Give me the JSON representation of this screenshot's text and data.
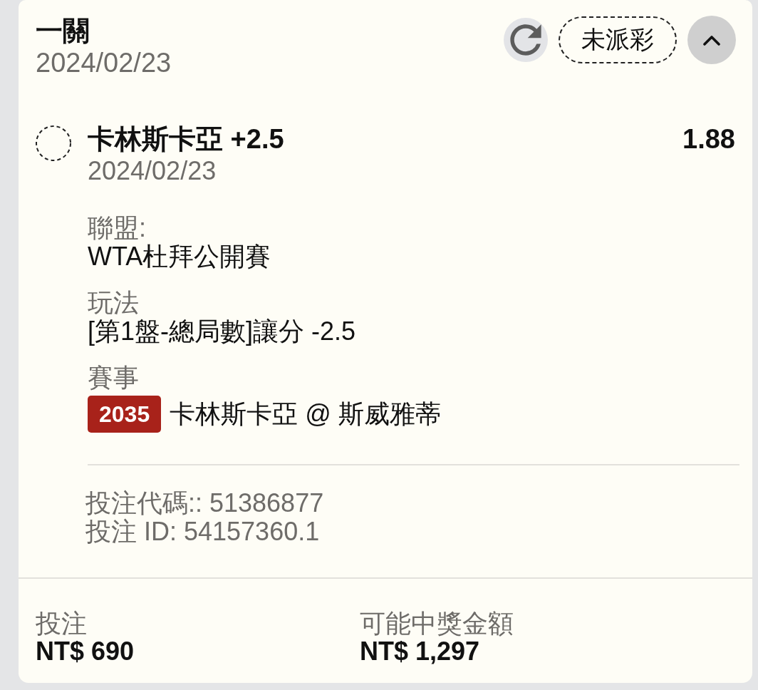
{
  "bet_card": {
    "title": "一關",
    "date": "2024/02/23",
    "status": "未派彩",
    "expanded": true
  },
  "selection": {
    "kind": "pending",
    "name": "卡林斯卡亞 +2.5",
    "odds": "1.88",
    "date": "2024/02/23",
    "details": [
      {
        "kind": "text",
        "label": "聯盟:",
        "value": "WTA杜拜公開賽"
      },
      {
        "kind": "text",
        "label": "玩法",
        "value": "[第1盤-總局數]讓分 -2.5"
      },
      {
        "kind": "match",
        "label": "賽事",
        "badge": "2035",
        "value": "卡林斯卡亞 @ 斯威雅蒂"
      }
    ],
    "bet_code": "投注代碼:: 51386877",
    "bet_id": "投注 ID: 54157360.1"
  },
  "summary": [
    {
      "label": "投注",
      "value": "NT$ 690"
    },
    {
      "label": "可能中獎金額",
      "value": "NT$ 1,297"
    }
  ]
}
